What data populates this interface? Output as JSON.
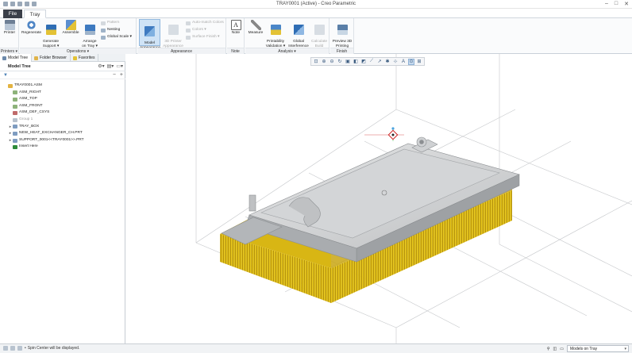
{
  "window": {
    "title": "TRAY0001 (Active) - Creo Parametric",
    "controls": [
      "–",
      "□",
      "✕"
    ]
  },
  "ribbon_tabs": {
    "file": "File",
    "tray": "Tray"
  },
  "ribbon": {
    "printers": {
      "label": "Printers ▾",
      "printer": "Printer"
    },
    "operations": {
      "label": "Operations ▾",
      "regenerate": "Regenerate",
      "generate_support": "Generate\nSupport ▾",
      "assemble": "Assemble",
      "arrange": "Arrange\non Tray ▾",
      "pattern": "Pattern",
      "nesting": "Nesting",
      "global_scale": "Global Scale ▾"
    },
    "appearance": {
      "label": "Appearance",
      "model_appearance": "Model\nAppearance",
      "printer_appearance": "3D Printer\nAppearance",
      "auto_match": "Auto-match Colors",
      "colors": "Colors ▾",
      "surface_finish": "Surface Finish ▾"
    },
    "note": {
      "label": "Note",
      "note": "Note"
    },
    "analysis": {
      "label": "Analysis ▾",
      "measure": "Measure",
      "printability": "Printability\nValidation ▾",
      "interference": "Global\nInterference",
      "calc_build": "Calculate\nBuild"
    },
    "finish": {
      "label": "Finish",
      "preview": "Preview 3D\nPrinting"
    }
  },
  "left_panel": {
    "tabs": [
      "Model Tree",
      "Folder Browser",
      "Favorites"
    ],
    "tree_title": "Model Tree",
    "items": [
      {
        "text": "TRAY0001.ASM",
        "expander": "",
        "icon": "assembly-icon",
        "dim": false
      },
      {
        "text": "ASM_RIGHT",
        "expander": "",
        "icon": "datum-plane-icon",
        "dim": false
      },
      {
        "text": "ASM_TOP",
        "expander": "",
        "icon": "datum-plane-icon",
        "dim": false
      },
      {
        "text": "ASM_FRONT",
        "expander": "",
        "icon": "datum-plane-icon",
        "dim": false
      },
      {
        "text": "ASM_DEF_CSYS",
        "expander": "",
        "icon": "csys-icon",
        "dim": false
      },
      {
        "text": "Group 1",
        "expander": "",
        "icon": "group-icon",
        "dim": true
      },
      {
        "text": "TRAY_BOX",
        "expander": "▸",
        "icon": "part-icon",
        "dim": false
      },
      {
        "text": "NEW_HEAT_EXCHANGER_CH.PRT",
        "expander": "▸",
        "icon": "part-icon",
        "dim": false
      },
      {
        "text": "SUPPORT_0001<<TRAY0001>>.PRT",
        "expander": "▸",
        "icon": "part-icon",
        "dim": false
      },
      {
        "text": "Insert Here",
        "expander": "",
        "icon": "insert-arrow-icon",
        "dim": false
      }
    ]
  },
  "view_toolbar": {
    "icons": [
      "refit-icon",
      "zoom-in-icon",
      "zoom-out-icon",
      "repaint-icon",
      "saved-views-icon",
      "display-style-icon",
      "perspective-icon",
      "plane-display-icon",
      "axis-display-icon",
      "point-display-icon",
      "csys-display-icon",
      "annotation-display-icon",
      "spin-center-icon",
      "support-display-icon"
    ],
    "glyphs": [
      "⊡",
      "⊕",
      "⊖",
      "↻",
      "▣",
      "◧",
      "◩",
      "⟋",
      "↗",
      "✱",
      "⊹",
      "A",
      "⊙",
      "⊞"
    ]
  },
  "status_bar": {
    "message": "Spin Center will be displayed.",
    "filter_value": "Models on Tray"
  },
  "colors": {
    "bristle_yellow": "#e8c71a",
    "model_gray": "#c7c9cb",
    "accent_blue": "#3e7ac0",
    "file_tab": "#3a3f49"
  }
}
